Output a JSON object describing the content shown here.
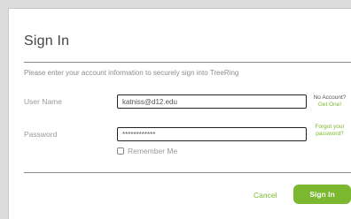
{
  "dialog": {
    "title": "Sign In",
    "instructions": "Please enter your account information to securely sign into TreeRing"
  },
  "form": {
    "username_label": "User Name",
    "username_value": "katniss@d12.edu",
    "password_label": "Password",
    "password_value": "************",
    "remember_label": "Remember Me",
    "remember_checked": false
  },
  "side_links": {
    "no_account_q": "No Account?",
    "get_one": "Get One!",
    "forgot_line1": "Forgot your",
    "forgot_line2": "password?"
  },
  "actions": {
    "cancel_label": "Cancel",
    "signin_label": "Sign In"
  },
  "colors": {
    "accent": "#7cb82f",
    "background": "#dcdcdc",
    "dialog": "#ffffff"
  }
}
